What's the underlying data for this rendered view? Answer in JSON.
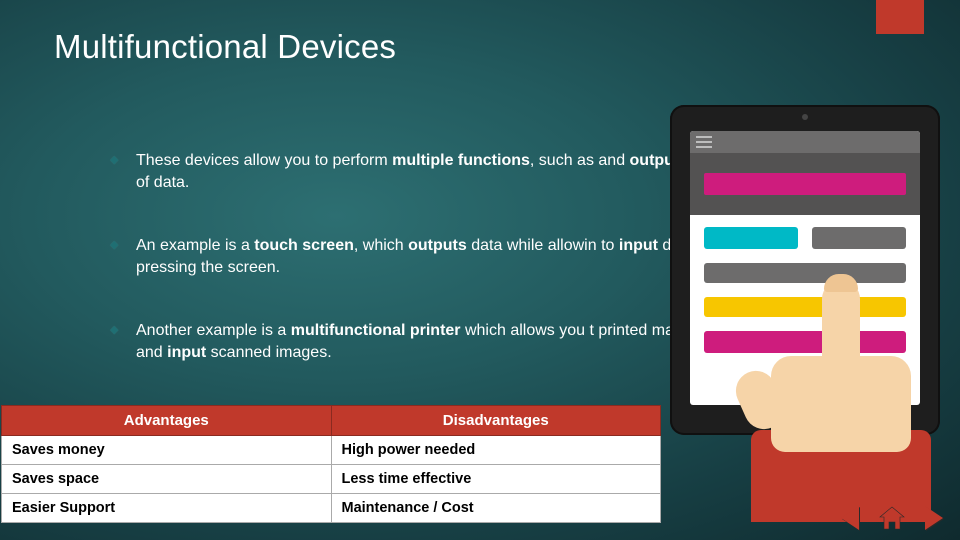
{
  "title": "Multifunctional Devices",
  "bullets": [
    {
      "pre": "These devices allow you to perform ",
      "b1": "multiple functions",
      "mid": ", such as ",
      "b2": "",
      "post": " and ",
      "b3": "outputting",
      "tail": " of data."
    },
    {
      "pre": "An example is a ",
      "b1": "touch screen",
      "mid": ", which ",
      "b2": "outputs",
      "post": " data while allowin to ",
      "b3": "input",
      "tail": " data by pressing the screen."
    },
    {
      "pre": "Another example is a ",
      "b1": "multifunctional printer",
      "mid": " which allows you t ",
      "b2": "",
      "post": " printed material and ",
      "b3": "input",
      "tail": " scanned images."
    }
  ],
  "table": {
    "headers": [
      "Advantages",
      "Disadvantages"
    ],
    "rows": [
      [
        "Saves money",
        "High power needed"
      ],
      [
        "Saves space",
        "Less time effective"
      ],
      [
        "Easier Support",
        "Maintenance / Cost"
      ]
    ]
  },
  "icons": {
    "prev": "previous-slide",
    "home": "home",
    "next": "next-slide"
  },
  "colors": {
    "accent": "#c0392b"
  }
}
